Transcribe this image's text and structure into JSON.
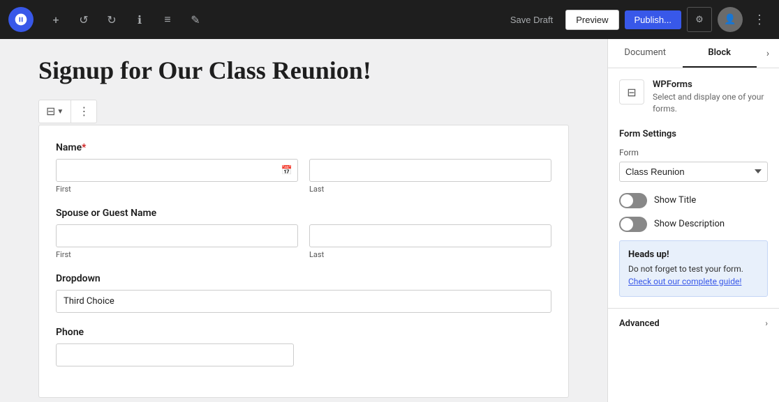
{
  "topbar": {
    "icons": {
      "add": "+",
      "undo": "↺",
      "redo": "↻",
      "info": "ℹ",
      "list": "≡",
      "edit": "✎"
    },
    "save_draft_label": "Save Draft",
    "preview_label": "Preview",
    "publish_label": "Publish..."
  },
  "page": {
    "title": "Signup for Our Class Reunion!"
  },
  "form": {
    "name_label": "Name",
    "name_required": "*",
    "first_sublabel": "First",
    "last_sublabel": "Last",
    "spouse_label": "Spouse or Guest Name",
    "dropdown_label": "Dropdown",
    "dropdown_value": "Third Choice",
    "phone_label": "Phone"
  },
  "sidebar": {
    "tab_document": "Document",
    "tab_block": "Block",
    "block_name": "WPForms",
    "block_desc": "Select and display one of your forms.",
    "form_settings_title": "Form Settings",
    "form_field_label": "Form",
    "form_selected": "Class Reunion",
    "show_title_label": "Show Title",
    "show_description_label": "Show Description",
    "heads_up_title": "Heads up!",
    "heads_up_text": "Do not forget to test your form.",
    "heads_up_link": "Check out our complete guide!",
    "advanced_label": "Advanced"
  }
}
